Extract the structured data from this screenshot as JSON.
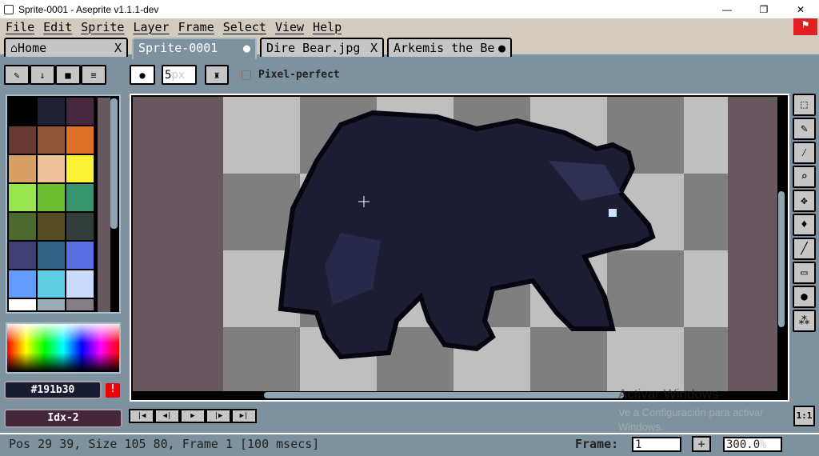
{
  "window": {
    "title": "Sprite-0001 - Aseprite v1.1.1-dev",
    "minimize": "—",
    "maximize": "❐",
    "close": "✕"
  },
  "menu": [
    "File",
    "Edit",
    "Sprite",
    "Layer",
    "Frame",
    "Select",
    "View",
    "Help"
  ],
  "tabs": [
    {
      "label": "Home",
      "icon": "home-icon",
      "close": "X"
    },
    {
      "label": "Sprite-0001",
      "close": "●"
    },
    {
      "label": "Dire Bear.jpg",
      "close": "X"
    },
    {
      "label": "Arkemis the Be",
      "close": "●"
    }
  ],
  "toolbar": {
    "brush_size": "5",
    "brush_unit": "px",
    "pixel_perfect": "Pixel-perfect"
  },
  "palette": {
    "colors": [
      "#000000",
      "#222034",
      "#45283c",
      "#663931",
      "#8f563b",
      "#df7126",
      "#d9a066",
      "#eec39a",
      "#fbf236",
      "#99e550",
      "#6abe30",
      "#37946e",
      "#4b692f",
      "#524b24",
      "#323c39",
      "#3f3f74",
      "#306082",
      "#5b6ee1",
      "#639bff",
      "#5fcde4",
      "#cbdbfc",
      "#ffffff",
      "#9badb7",
      "#847e87"
    ]
  },
  "color": {
    "hex": "#191b30",
    "index": "Idx-2",
    "warning": "!"
  },
  "tools": [
    "rectangular-marquee",
    "pencil",
    "eyedropper",
    "zoom",
    "move",
    "fill",
    "line",
    "rectangle",
    "contour",
    "spray"
  ],
  "status": {
    "text": "Pos 29 39, Size 105 80, Frame 1 [100 msecs]",
    "frame_label": "Frame:",
    "frame_value": "1",
    "add": "+",
    "zoom": "300.0",
    "zoom_unit": "%",
    "one_to_one": "1:1"
  },
  "watermark": {
    "title": "Activar Windows",
    "subtitle": "Ve a Configuración para activar Windows."
  }
}
